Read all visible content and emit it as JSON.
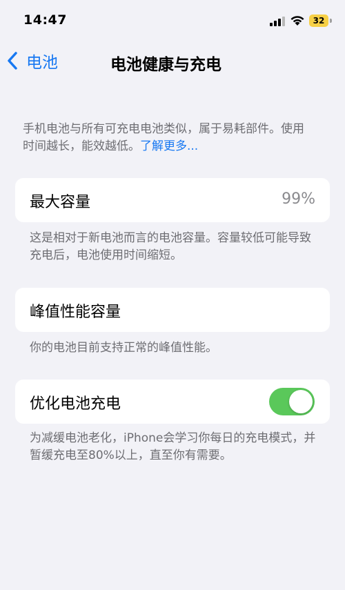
{
  "status_bar": {
    "time": "14:47",
    "battery_level": "32",
    "battery_color": "#f7d046"
  },
  "nav": {
    "back_label": "电池",
    "title": "电池健康与充电"
  },
  "intro": {
    "text": "手机电池与所有可充电电池类似，属于易耗部件。使用时间越长，能效越低。",
    "link": "了解更多..."
  },
  "max_capacity": {
    "label": "最大容量",
    "value": "99%",
    "footnote": "这是相对于新电池而言的电池容量。容量较低可能导致充电后，电池使用时间缩短。"
  },
  "peak_performance": {
    "label": "峰值性能容量",
    "footnote": "你的电池目前支持正常的峰值性能。"
  },
  "optimized_charging": {
    "label": "优化电池充电",
    "enabled": true,
    "toggle_color": "#5ac85a",
    "footnote": "为减缓电池老化，iPhone会学习你每日的充电模式，并暂缓充电至80%以上，直至你有需要。"
  },
  "accent_color": "#1778f2"
}
